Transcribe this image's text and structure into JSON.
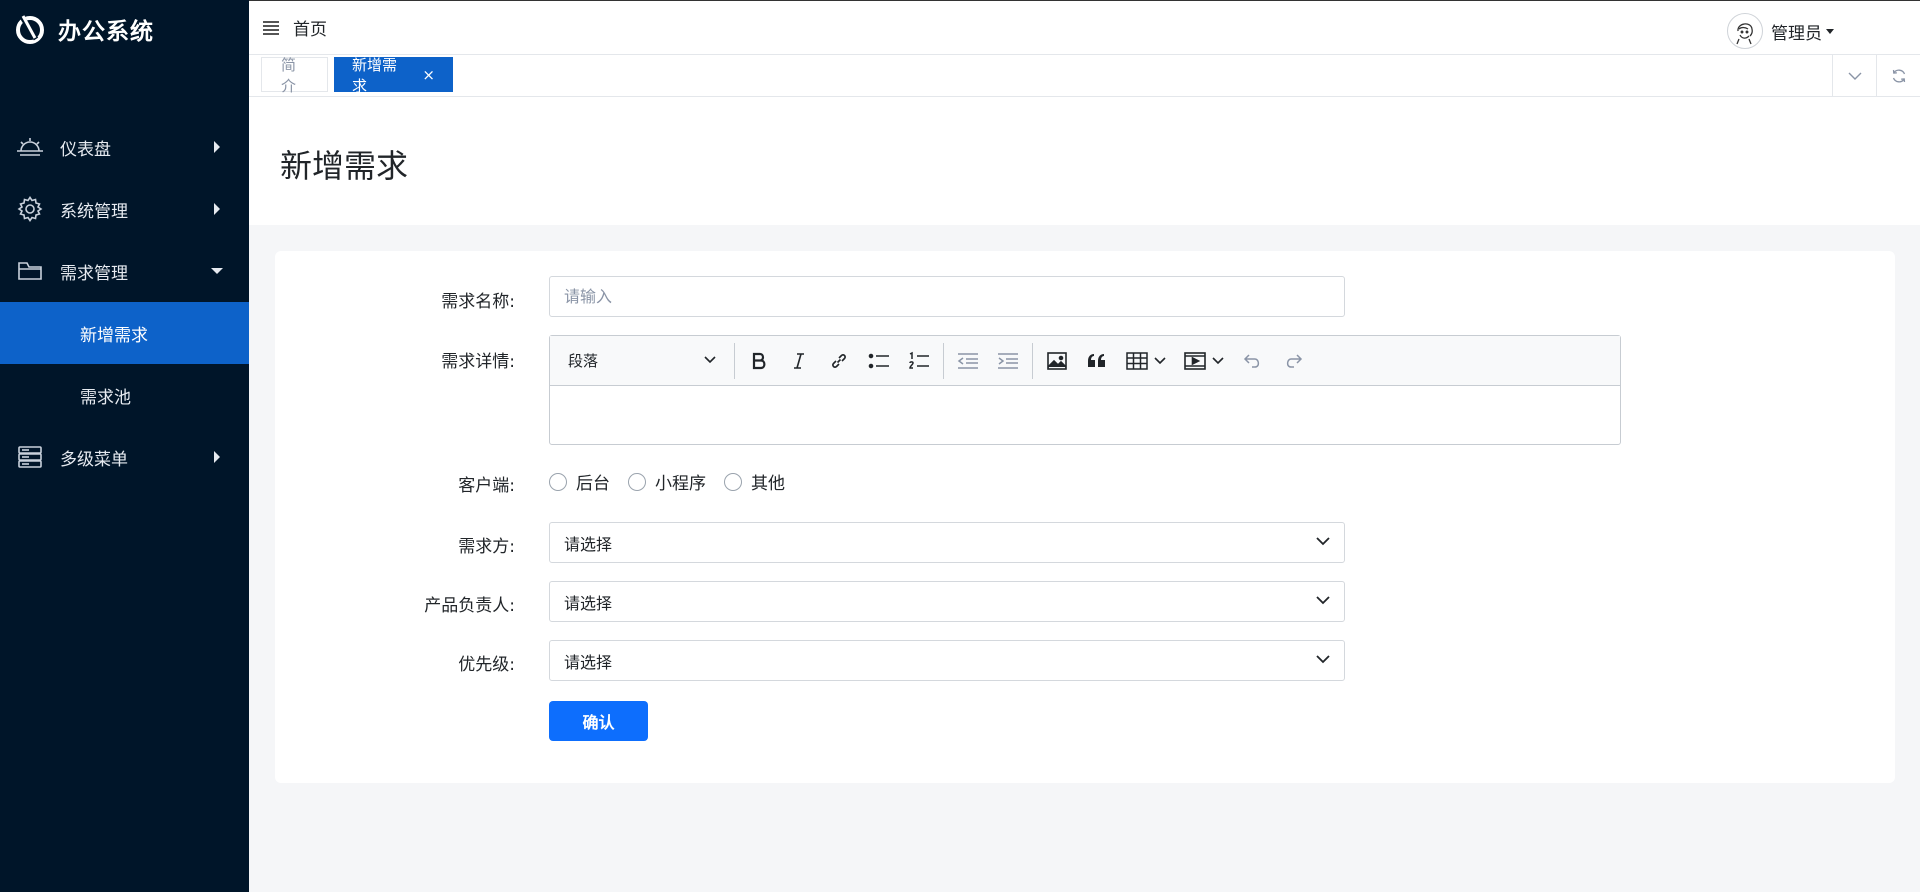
{
  "app": {
    "title": "办公系统"
  },
  "sidebar": {
    "items": [
      {
        "label": "仪表盘",
        "icon": "dashboard-icon"
      },
      {
        "label": "系统管理",
        "icon": "gear-icon"
      },
      {
        "label": "需求管理",
        "icon": "folder-icon",
        "expanded": true,
        "children": [
          {
            "label": "新增需求",
            "active": true
          },
          {
            "label": "需求池",
            "active": false
          }
        ]
      },
      {
        "label": "多级菜单",
        "icon": "server-stack-icon"
      }
    ]
  },
  "topbar": {
    "home": "首页",
    "user": "管理员"
  },
  "tabs": {
    "intro": "简介",
    "active": "新增需求",
    "close": "×"
  },
  "page": {
    "title": "新增需求"
  },
  "form": {
    "name": {
      "label": "需求名称:",
      "placeholder": "请输入",
      "value": ""
    },
    "detail": {
      "label": "需求详情:",
      "block_format": "段落"
    },
    "client": {
      "label": "客户端:",
      "options": [
        "后台",
        "小程序",
        "其他"
      ]
    },
    "requester": {
      "label": "需求方:",
      "value": "请选择"
    },
    "owner": {
      "label": "产品负责人:",
      "value": "请选择"
    },
    "priority": {
      "label": "优先级:",
      "value": "请选择"
    },
    "submit": "确认"
  },
  "colors": {
    "sidebar_bg": "#001529",
    "accent": "#0d62c9",
    "primary_button": "#0d6efd"
  }
}
